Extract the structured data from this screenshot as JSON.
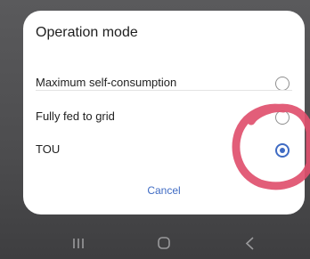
{
  "dialog": {
    "title": "Operation mode",
    "options": [
      {
        "label": "Maximum self-consumption",
        "selected": false
      },
      {
        "label": "Fully fed to grid",
        "selected": false
      },
      {
        "label": "TOU",
        "selected": true
      }
    ],
    "cancel_label": "Cancel"
  },
  "navbar": {
    "buttons": [
      "recents-icon",
      "home-icon",
      "back-icon"
    ]
  },
  "colors": {
    "accent": "#3f6bc3",
    "annotation": "#e0506e"
  }
}
